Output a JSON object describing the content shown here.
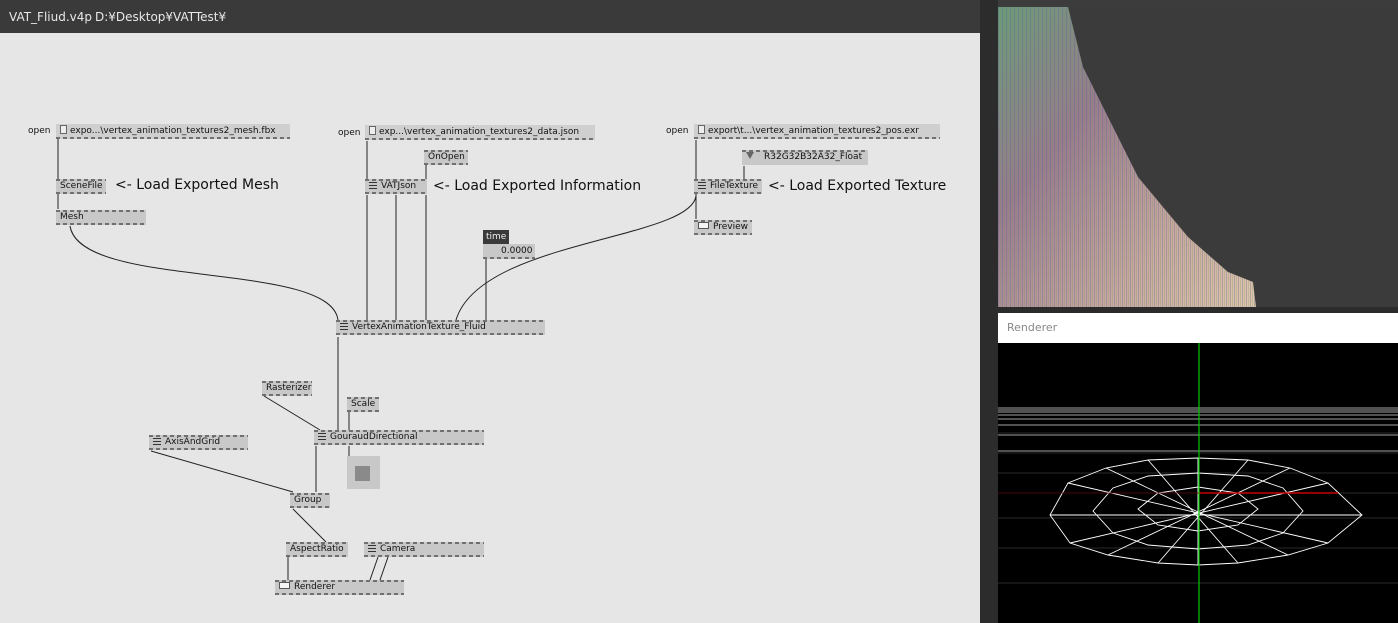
{
  "title": {
    "filename": "VAT_Fliud.v4p",
    "path": "D:¥Desktop¥VATTest¥"
  },
  "nodes": {
    "open1_label": "open",
    "mesh_file": "expo...\\vertex_animation_textures2_mesh.fbx",
    "scenefile": "SceneFile",
    "mesh": "Mesh",
    "open2_label": "open",
    "data_file": "exp...\\vertex_animation_textures2_data.json",
    "onopen": "OnOpen",
    "vatjson": "VATJson",
    "open3_label": "open",
    "pos_file": "export\\t...\\vertex_animation_textures2_pos.exr",
    "format": "R32G32B32A32_Float",
    "filetexture": "FileTexture",
    "preview": "Preview",
    "time_label": "time",
    "time_value": "0.0000",
    "vat_fluid": "VertexAnimationTexture_Fluid",
    "rasterizer": "Rasterizer",
    "scale": "Scale",
    "axisandgrid": "AxisAndGrid",
    "gouraud": "GouraudDirectional",
    "group": "Group",
    "aspectratio": "AspectRatio",
    "camera": "Camera",
    "renderer": "Renderer"
  },
  "annotations": {
    "mesh": "<- Load Exported Mesh",
    "info": "<- Load Exported Information",
    "texture": "<- Load Exported Texture"
  },
  "panels": {
    "renderer_title": "Renderer"
  },
  "colors": {
    "patch_bg": "#e6e6e6",
    "node_bg": "#c8c8c8",
    "titlebar_bg": "#3a3a3a",
    "grid_line": "#ffffff",
    "axis_green": "#00c800",
    "axis_red": "#c80000"
  }
}
